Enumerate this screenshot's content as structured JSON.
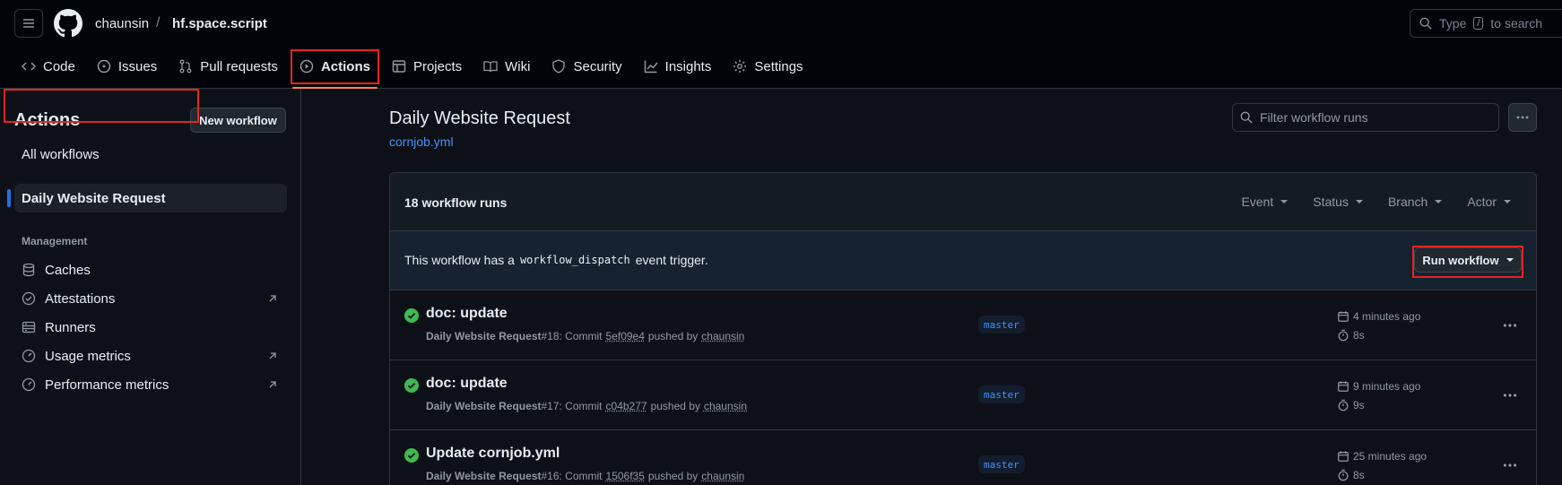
{
  "header": {
    "owner": "chaunsin",
    "separator": "/",
    "repo": "hf.space.script",
    "search_type": "Type",
    "search_key": "/",
    "search_rest": "to search"
  },
  "tabs": [
    {
      "label": "Code",
      "icon": "code-icon"
    },
    {
      "label": "Issues",
      "icon": "issue-icon"
    },
    {
      "label": "Pull requests",
      "icon": "pull-request-icon"
    },
    {
      "label": "Actions",
      "icon": "play-icon",
      "active": true
    },
    {
      "label": "Projects",
      "icon": "table-icon"
    },
    {
      "label": "Wiki",
      "icon": "book-icon"
    },
    {
      "label": "Security",
      "icon": "shield-icon"
    },
    {
      "label": "Insights",
      "icon": "graph-icon"
    },
    {
      "label": "Settings",
      "icon": "gear-icon"
    }
  ],
  "sidebar": {
    "title": "Actions",
    "new_workflow": "New workflow",
    "all_workflows": "All workflows",
    "selected_workflow": "Daily Website Request",
    "section": "Management",
    "items": [
      {
        "label": "Caches",
        "icon": "database-icon",
        "external": false
      },
      {
        "label": "Attestations",
        "icon": "verified-icon",
        "external": true
      },
      {
        "label": "Runners",
        "icon": "server-icon",
        "external": false
      },
      {
        "label": "Usage metrics",
        "icon": "meter-icon",
        "external": true
      },
      {
        "label": "Performance metrics",
        "icon": "meter-icon",
        "external": true
      }
    ]
  },
  "main": {
    "title": "Daily Website Request",
    "file": "cornjob.yml",
    "filter_placeholder": "Filter workflow runs",
    "runs_count": "18 workflow runs",
    "filters": [
      "Event",
      "Status",
      "Branch",
      "Actor"
    ],
    "dispatch_pre": "This workflow has a",
    "dispatch_code": "workflow_dispatch",
    "dispatch_post": "event trigger.",
    "run_workflow": "Run workflow",
    "runs": [
      {
        "title": "doc: update",
        "workflow": "Daily Website Request",
        "number": "#18",
        "commit_label": ": Commit",
        "commit": "5ef09e4",
        "pushed_by": "pushed by",
        "author": "chaunsin",
        "branch": "master",
        "time": "4 minutes ago",
        "duration": "8s"
      },
      {
        "title": "doc: update",
        "workflow": "Daily Website Request",
        "number": "#17",
        "commit_label": ": Commit",
        "commit": "c04b277",
        "pushed_by": "pushed by",
        "author": "chaunsin",
        "branch": "master",
        "time": "9 minutes ago",
        "duration": "9s"
      },
      {
        "title": "Update cornjob.yml",
        "workflow": "Daily Website Request",
        "number": "#16",
        "commit_label": ": Commit",
        "commit": "1506f35",
        "pushed_by": "pushed by",
        "author": "chaunsin",
        "branch": "master",
        "time": "25 minutes ago",
        "duration": "8s"
      }
    ]
  },
  "colors": {
    "success": "#3fb950",
    "link": "#4493f8",
    "active_underline": "#f78166",
    "highlight": "#e5251f"
  }
}
